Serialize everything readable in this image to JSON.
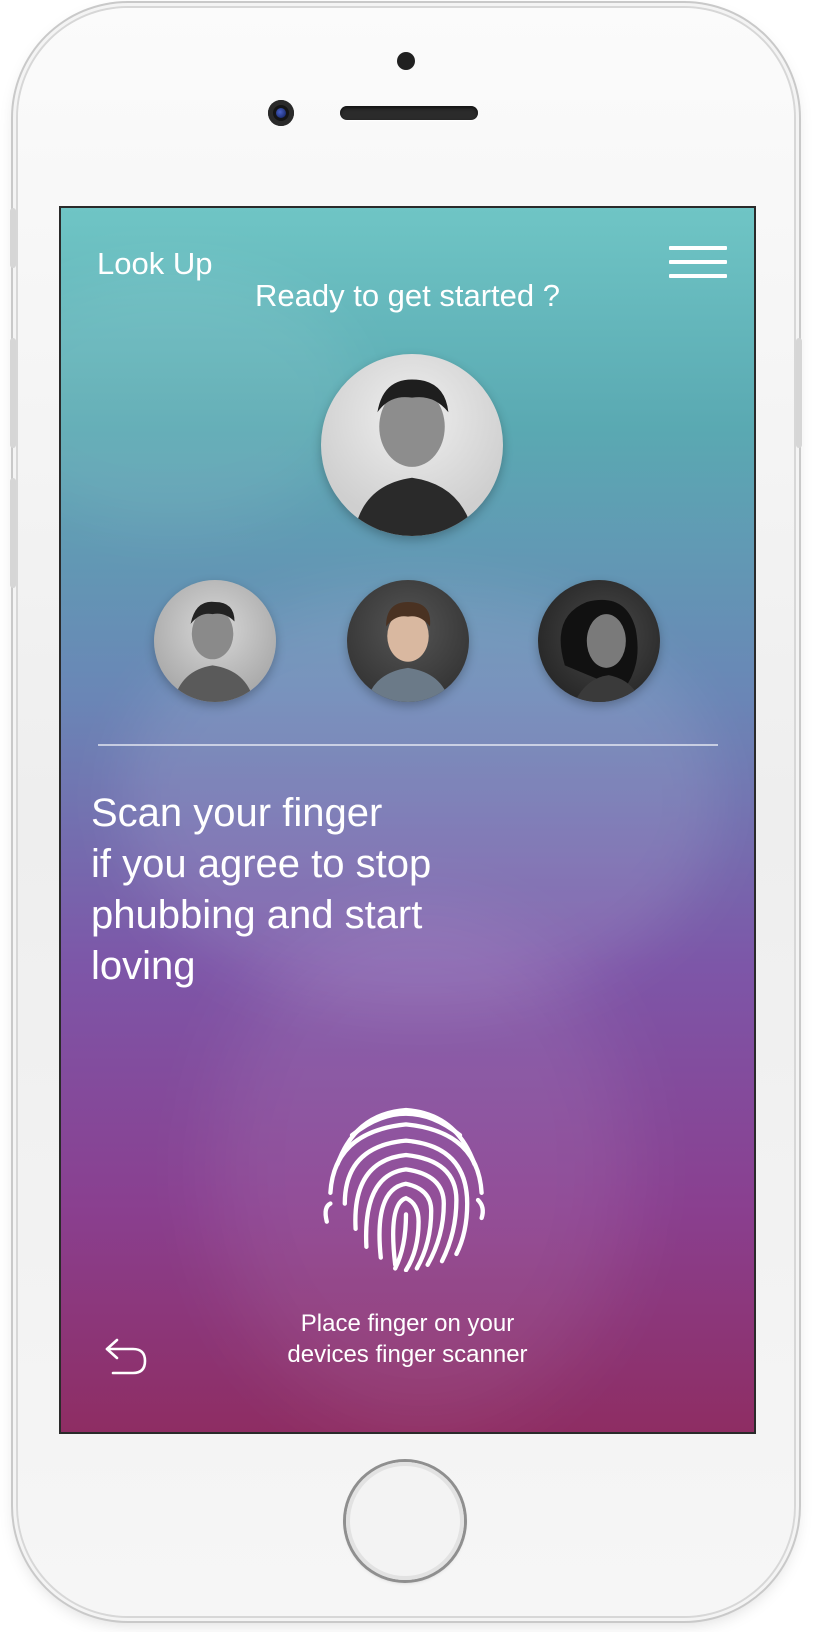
{
  "app": {
    "title": "Look Up",
    "subtitle": "Ready to get started ?"
  },
  "header": {
    "menu_icon": "hamburger-menu-icon"
  },
  "people": [
    {
      "role": "featured",
      "icon": "person-photo"
    },
    {
      "role": "member",
      "icon": "person-photo"
    },
    {
      "role": "member",
      "icon": "person-photo"
    },
    {
      "role": "member",
      "icon": "person-photo"
    }
  ],
  "prompt": {
    "lines": [
      "Scan your finger",
      "if you agree to stop",
      "phubbing and start",
      "loving"
    ]
  },
  "scanner": {
    "icon": "fingerprint-icon",
    "instruction_line1": "Place finger on your",
    "instruction_line2": "devices finger scanner"
  },
  "footer": {
    "back_icon": "back-arrow-icon"
  },
  "colors": {
    "gradient_top": "#6fc5c5",
    "gradient_middle": "#7d56a8",
    "gradient_bottom": "#8e2d63",
    "text": "#ffffff"
  }
}
